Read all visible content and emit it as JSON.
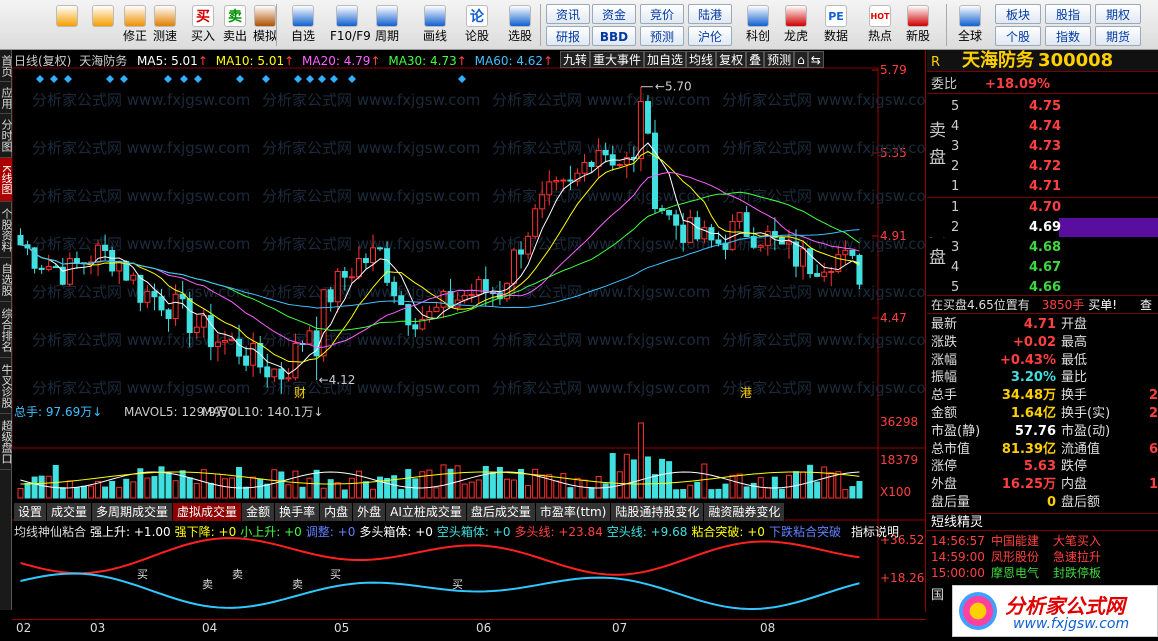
{
  "toolbar": {
    "main": [
      {
        "label": "",
        "icon": "back-arrow-icon"
      },
      {
        "label": "",
        "icon": "up-down-arrow-icon"
      },
      {
        "label": "修正",
        "icon": "clock-icon"
      },
      {
        "label": "测速",
        "icon": "clock-check-icon"
      },
      {
        "label": "买入",
        "icon": "buy-icon",
        "glyph": "买"
      },
      {
        "label": "卖出",
        "icon": "sell-icon",
        "glyph": "卖"
      },
      {
        "label": "模拟",
        "icon": "hammer-icon"
      },
      {
        "label": "自选",
        "icon": "home-icon"
      },
      {
        "label": "F10/F9",
        "icon": "document-icon"
      },
      {
        "label": "周期",
        "icon": "cycle-icon"
      },
      {
        "label": "画线",
        "icon": "pen-icon"
      },
      {
        "label": "论股",
        "icon": "discuss-icon",
        "glyph": "论"
      },
      {
        "label": "选股",
        "icon": "chart-circle-icon"
      }
    ],
    "small_buttons": [
      [
        "资讯",
        "资金",
        "竞价",
        "陆港"
      ],
      [
        "研报",
        "BBD",
        "预测",
        "沪伦"
      ]
    ],
    "main2": [
      {
        "label": "科创",
        "icon": "rocket-icon"
      },
      {
        "label": "龙虎",
        "icon": "dragon-icon"
      },
      {
        "label": "数据",
        "icon": "pe-icon",
        "glyph": "PE"
      },
      {
        "label": "热点",
        "icon": "hot-icon",
        "glyph": "HOT"
      },
      {
        "label": "新股",
        "icon": "new-stock-icon"
      },
      {
        "label": "全球",
        "icon": "globe-icon"
      }
    ],
    "right_buttons": [
      [
        "板块",
        "股指",
        "期权"
      ],
      [
        "个股",
        "指数",
        "期货"
      ]
    ]
  },
  "left_tabs": [
    {
      "label": "首页",
      "active": false
    },
    {
      "label": "应用",
      "active": false
    },
    {
      "label": "分时图",
      "active": false
    },
    {
      "label": "K线图",
      "active": true
    },
    {
      "label": "个股资料",
      "active": false
    },
    {
      "label": "自选股",
      "active": false
    },
    {
      "label": "综合排名",
      "active": false
    },
    {
      "label": "牛叉诊股",
      "active": false
    },
    {
      "label": "超级盘口",
      "active": false
    }
  ],
  "infobar": {
    "period": "日线(复权)",
    "stock_name": "天海防务",
    "ma5": "MA5: 5.01",
    "ma10": "MA10: 5.01",
    "ma20": "MA20: 4.79",
    "ma30": "MA30: 4.73",
    "ma60": "MA60: 4.62",
    "colors": {
      "ma5": "#ffffff",
      "ma10": "#ffff00",
      "ma20": "#ff60ff",
      "ma30": "#40ff40",
      "ma60": "#40c0ff"
    }
  },
  "top_buttons": [
    "九转",
    "重大事件",
    "加自选",
    "均线",
    "复权",
    "叠",
    "预测",
    "⌂",
    "⇆"
  ],
  "price_axis": [
    "5.79",
    "5.35",
    "4.91",
    "4.47"
  ],
  "annotations": {
    "high": "5.70",
    "low": "4.12",
    "tag1": "财",
    "tag2": "港",
    "buy": "买",
    "sell": "卖"
  },
  "watermark": "分析家公式网 www.fxjgsw.com",
  "volume_bar": {
    "total": "总手: 97.69万",
    "mavol5": "MAVOL5: 129.9万",
    "mavol10": "MAVOL10: 140.1万",
    "axis": [
      "36298",
      "18379",
      "X100"
    ]
  },
  "indicator_tabs": [
    "设置",
    "成交量",
    "多周期成交量",
    "虚拟成交量",
    "金额",
    "换手率",
    "内盘",
    "外盘",
    "AI立桩成交量",
    "盘后成交量",
    "市盈率(ttm)",
    "陆股通持股变化",
    "融资融券变化"
  ],
  "indicator_tab_active": 3,
  "indicator_bar": {
    "name": "均线神仙粘合",
    "items": [
      {
        "text": "强上升: +1.00",
        "color": "#ffffff"
      },
      {
        "text": "强下降: +0",
        "color": "#ffff00"
      },
      {
        "text": "小上升: +0",
        "color": "#40ff40"
      },
      {
        "text": "调整: +0",
        "color": "#6080ff"
      },
      {
        "text": "多头箱体: +0",
        "color": "#ffffff"
      },
      {
        "text": "空头箱体: +0",
        "color": "#40e0e0"
      },
      {
        "text": "多头线: +23.84",
        "color": "#ff4040"
      },
      {
        "text": "空头线: +9.68",
        "color": "#40e0e0"
      },
      {
        "text": "粘合突破: +0",
        "color": "#ffff00"
      },
      {
        "text": "下跌粘合突破",
        "color": "#6080ff"
      }
    ],
    "help": "指标说明",
    "axis": [
      "36.52",
      "18.26"
    ]
  },
  "dates": [
    "02",
    "03",
    "04",
    "05",
    "06",
    "07",
    "08"
  ],
  "quote": {
    "code_label": "R",
    "name": "天海防务",
    "code": "300008",
    "weibi_label": "委比",
    "weibi": "+18.09%",
    "sell_label": "卖盘",
    "buy_label": "买盘",
    "sell": [
      {
        "level": "5",
        "price": "4.75"
      },
      {
        "level": "4",
        "price": "4.74"
      },
      {
        "level": "3",
        "price": "4.73"
      },
      {
        "level": "2",
        "price": "4.72"
      },
      {
        "level": "1",
        "price": "4.71"
      }
    ],
    "buy": [
      {
        "level": "1",
        "price": "4.70"
      },
      {
        "level": "2",
        "price": "4.69"
      },
      {
        "level": "3",
        "price": "4.68"
      },
      {
        "level": "4",
        "price": "4.67"
      },
      {
        "level": "5",
        "price": "4.66"
      }
    ],
    "order_note": "在买盘4.65位置有",
    "order_vol": "3850手",
    "order_action": "买单!",
    "order_query": "查",
    "stats_left": [
      {
        "label": "最新",
        "value": "4.71",
        "color": "red"
      },
      {
        "label": "涨跌",
        "value": "+0.02",
        "color": "red"
      },
      {
        "label": "涨幅",
        "value": "+0.43%",
        "color": "red"
      },
      {
        "label": "振幅",
        "value": "3.20%",
        "color": "cyan"
      },
      {
        "label": "总手",
        "value": "34.48万",
        "color": "yellow"
      },
      {
        "label": "金额",
        "value": "1.64亿",
        "color": "yellow"
      },
      {
        "label": "市盈(静)",
        "value": "57.76",
        "color": "white"
      },
      {
        "label": "总市值",
        "value": "81.39亿",
        "color": "yellow"
      },
      {
        "label": "涨停",
        "value": "5.63",
        "color": "red"
      },
      {
        "label": "外盘",
        "value": "16.25万",
        "color": "red"
      },
      {
        "label": "盘后量",
        "value": "0",
        "color": "yellow"
      }
    ],
    "stats_right": [
      {
        "label": "开盘",
        "value": ""
      },
      {
        "label": "最高",
        "value": ""
      },
      {
        "label": "最低",
        "value": ""
      },
      {
        "label": "量比",
        "value": ""
      },
      {
        "label": "换手",
        "value": "2"
      },
      {
        "label": "换手(实)",
        "value": "2"
      },
      {
        "label": "市盈(动)",
        "value": ""
      },
      {
        "label": "流通值",
        "value": "67"
      },
      {
        "label": "跌停",
        "value": ""
      },
      {
        "label": "内盘",
        "value": "18"
      },
      {
        "label": "盘后额",
        "value": ""
      }
    ],
    "elf_title": "短线精灵",
    "elf": [
      {
        "time": "14:56:57",
        "name": "中国能建",
        "event": "大笔买入"
      },
      {
        "time": "14:59:00",
        "name": "凤形股份",
        "event": "急速拉升"
      },
      {
        "time": "15:00:00",
        "name": "摩恩电气",
        "event": "封跌停板"
      }
    ],
    "guo": "国"
  },
  "footer_logo": {
    "name": "分析家公式网",
    "url": "www.fxjgsw.com"
  }
}
